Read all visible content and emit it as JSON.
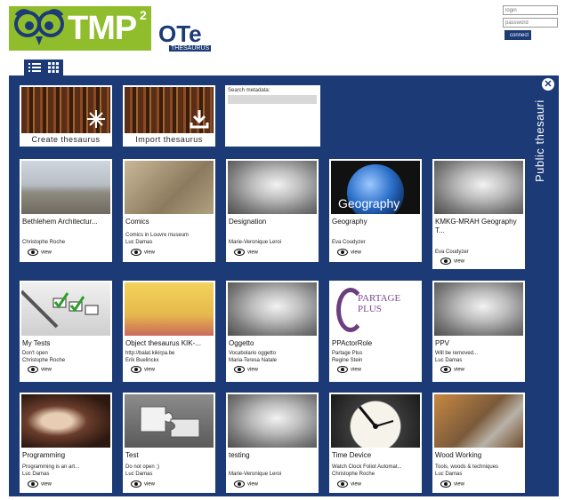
{
  "header": {
    "logo_text": "TMP",
    "logo_sup": "2",
    "ote_text": "OTe",
    "ote_sub": "THESAURUS",
    "login_placeholder": "login",
    "password_placeholder": "password",
    "connect_label": "connect"
  },
  "panel": {
    "side_title": "Public thesauri",
    "create_label": "Create thesaurus",
    "import_label": "Import thesaurus",
    "search_label": "Search metadata:",
    "view_label": "view"
  },
  "cards": [
    {
      "title": "Bethlehem Architectur...",
      "desc": "",
      "author": "Christophe Roche"
    },
    {
      "title": "Comics",
      "desc": "Comics in Louvre museum",
      "author": "Luc Damas"
    },
    {
      "title": "Designation",
      "desc": "",
      "author": "Marie-Veronique Leroi"
    },
    {
      "title": "Geography",
      "desc": "",
      "author": "Eva Coudyzer",
      "img_text": "Geography"
    },
    {
      "title": "KMKG-MRAH Geography T...",
      "desc": "",
      "author": "Eva Coudyzer"
    },
    {
      "title": "My Tests",
      "desc": "Don't open",
      "author": "Christophe Roche"
    },
    {
      "title": "Object thesaurus KIK-...",
      "desc": "http://balat.kikirpa.be",
      "author": "Erik Buelinckx"
    },
    {
      "title": "Oggetto",
      "desc": "Vocabolario oggetto",
      "author": "Maria-Teresa Natale"
    },
    {
      "title": "PPActorRole",
      "desc": "Partage Plus",
      "author": "Regine Stein",
      "img_text": "PARTAGE PLUS"
    },
    {
      "title": "PPV",
      "desc": "Will be removed...",
      "author": "Luc Damas"
    },
    {
      "title": "Programming",
      "desc": "Programming is an art...",
      "author": "Luc Damas"
    },
    {
      "title": "Test",
      "desc": "Do not open ;)",
      "author": "Luc Damas"
    },
    {
      "title": "testing",
      "desc": "",
      "author": "Marie-Veronique Leroi"
    },
    {
      "title": "Time Device",
      "desc": "Watch Clock Foliot Automat...",
      "author": "Christophe Roche"
    },
    {
      "title": "Wood Working",
      "desc": "Tools, woods & techniques",
      "author": "Luc Damas"
    }
  ]
}
